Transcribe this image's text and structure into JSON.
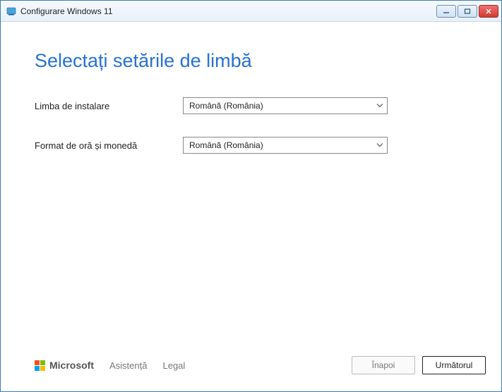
{
  "window": {
    "title": "Configurare Windows 11"
  },
  "heading": "Selectați setările de limbă",
  "fields": {
    "install_language": {
      "label": "Limba de instalare",
      "value": "Română (România)"
    },
    "time_currency": {
      "label": "Format de oră și monedă",
      "value": "Română (România)"
    }
  },
  "footer": {
    "brand": "Microsoft",
    "support": "Asistență",
    "legal": "Legal",
    "back": "Înapoi",
    "next": "Următorul"
  }
}
